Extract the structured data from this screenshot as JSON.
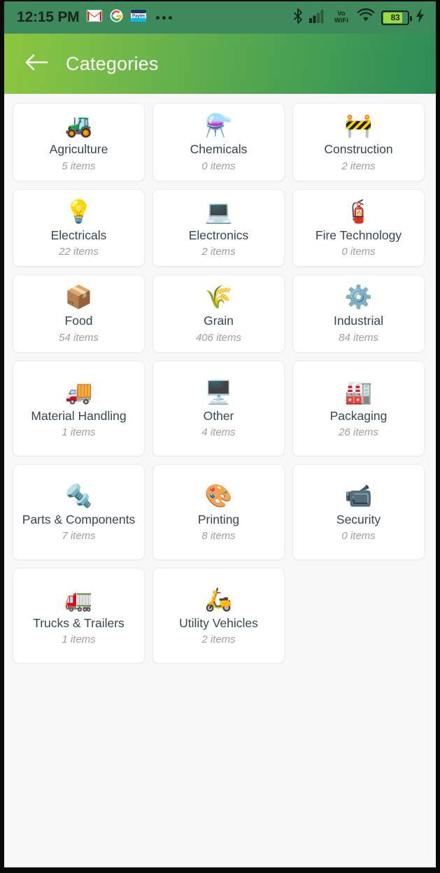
{
  "status_bar": {
    "time": "12:15 PM",
    "notification_icons": [
      "gmail-icon",
      "google-icon",
      "paytm-icon",
      "more-dots-icon"
    ],
    "system_icons": [
      "bluetooth-icon",
      "cellular-signal-icon",
      "vowifi-icon",
      "wifi-icon",
      "battery-icon",
      "charging-bolt-icon"
    ],
    "vowifi_label_top": "Vo",
    "vowifi_label_bottom": "WiFi",
    "battery_percent": "83",
    "battery_level": 83,
    "charging": true
  },
  "app_bar": {
    "title": "Categories",
    "back_icon": "arrow-left-icon",
    "gradient_start": "#8cc63f",
    "gradient_end": "#2e8b57"
  },
  "colors": {
    "page_background": "#f8f8f8",
    "card_background": "#ffffff",
    "card_border": "#ececec",
    "title_text": "#37474f",
    "count_text": "#9e9e9e",
    "status_bar_bg": "#3e8a5c",
    "battery_fill": "#9ddc3f"
  },
  "categories": [
    {
      "name": "Agriculture",
      "count": "5 items",
      "icon": "tractor-icon",
      "glyph": "🚜"
    },
    {
      "name": "Chemicals",
      "count": "0 items",
      "icon": "flask-icon",
      "glyph": "⚗️"
    },
    {
      "name": "Construction",
      "count": "2 items",
      "icon": "excavator-icon",
      "glyph": "🚧"
    },
    {
      "name": "Electricals",
      "count": "22 items",
      "icon": "light-bulb-icon",
      "glyph": "💡"
    },
    {
      "name": "Electronics",
      "count": "2 items",
      "icon": "microchip-icon",
      "glyph": "💻"
    },
    {
      "name": "Fire Technology",
      "count": "0 items",
      "icon": "fire-hydrant-icon",
      "glyph": "🧯"
    },
    {
      "name": "Food",
      "count": "54 items",
      "icon": "conveyor-belt-icon",
      "glyph": "📦"
    },
    {
      "name": "Grain",
      "count": "406 items",
      "icon": "wheat-icon",
      "glyph": "🌾"
    },
    {
      "name": "Industrial",
      "count": "84 items",
      "icon": "gears-icon",
      "glyph": "⚙️"
    },
    {
      "name": "Material Handling",
      "count": "1 items",
      "icon": "forklift-icon",
      "glyph": "🚚"
    },
    {
      "name": "Other",
      "count": "4 items",
      "icon": "machine-icon",
      "glyph": "🖥️"
    },
    {
      "name": "Packaging",
      "count": "26 items",
      "icon": "packaging-gear-icon",
      "glyph": "🏭"
    },
    {
      "name": "Parts & Components",
      "count": "7 items",
      "icon": "screw-bolt-icon",
      "glyph": "🔩"
    },
    {
      "name": "Printing",
      "count": "8 items",
      "icon": "printing-icon",
      "glyph": "🎨"
    },
    {
      "name": "Security",
      "count": "0 items",
      "icon": "security-camera-icon",
      "glyph": "📹"
    },
    {
      "name": "Trucks & Trailers",
      "count": "1 items",
      "icon": "truck-icon",
      "glyph": "🚛"
    },
    {
      "name": "Utility Vehicles",
      "count": "2 items",
      "icon": "atv-icon",
      "glyph": "🛵"
    }
  ]
}
